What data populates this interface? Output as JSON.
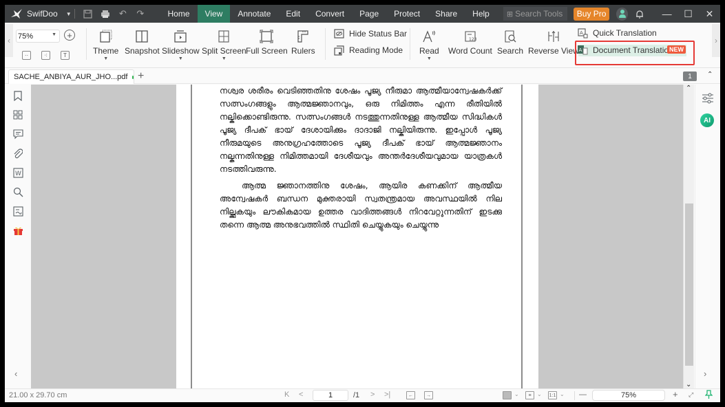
{
  "titlebar": {
    "app_name": "SwifDoo",
    "menu": [
      "Home",
      "View",
      "Annotate",
      "Edit",
      "Convert",
      "Page",
      "Protect",
      "Share",
      "Help"
    ],
    "active_menu": "View",
    "search_placeholder": "Search Tools",
    "buy_pro": "Buy Pro"
  },
  "ribbon": {
    "zoom_value": "75%",
    "tools": {
      "theme": "Theme",
      "snapshot": "Snapshot",
      "slideshow": "Slideshow",
      "split_screen": "Split Screen",
      "full_screen": "Full Screen",
      "rulers": "Rulers",
      "hide_status_bar": "Hide Status Bar",
      "reading_mode": "Reading Mode",
      "read": "Read",
      "word_count": "Word Count",
      "search": "Search",
      "reverse_view": "Reverse View",
      "quick_translation": "Quick Translation",
      "document_translation": "Document Translation",
      "new_badge": "NEW"
    }
  },
  "tabs": {
    "doc_tab": "SACHE_ANBIYA_AUR_JHO...pdf",
    "page_badge": "1"
  },
  "document": {
    "paragraph1": "നശ്വര ശരീരം വെടിഞ്ഞതിനു ശേഷം പൂജ്യ നീരുമാ ആത്മീയാന്വേഷകർക്ക് സത്സംഗങ്ങളും ആത്മജ്ഞാനവും, ഒരു നിമിത്തം എന്ന രീതിയിൽ നല്കിക്കൊണ്ടിരുന്നു. സത്സംഗങ്ങൾ നടത്തുന്നതിനുള്ള ആത്മീയ സിദ്ധികൾ പൂജ്യ ദീപക് ഭായ് ദേശായിക്കും ദാദാജി നല്കിയിരുന്നു. ഇപ്പോൾ പൂജ്യ നീരുമയുടെ അനുഗ്രഹത്തോടെ പൂജ്യ ദീപക് ഭായ് ആത്മജ്ഞാനം നല്കുന്നതിനുള്ള നിമിത്തമായി ദേശീയവും അന്തർദേശീയവുമായ യാത്രകൾ നടത്തിവരുന്നു.",
    "paragraph2": "ആത്മ ജ്ഞാനത്തിനു ശേഷം, ആയിര കണക്കിന് ആത്മീയ അന്വേഷകർ ബന്ധന മുക്തരായി സ്വതന്ത്രമായ അവസ്ഥയിൽ നില നില്ക്കുകയും ലൗകികമായ ഉത്തര വാദിത്തങ്ങൾ നിറവേറ്റുന്നതിന് ഇടക്കു തന്നെ ആത്മ അനുഭവത്തിൽ സ്ഥിതി ചെയ്യുകയും ചെയ്യുന്നു"
  },
  "sidebar_left": [
    "bookmark-icon",
    "thumbnails-icon",
    "comment-icon",
    "attachment-icon",
    "word-icon",
    "search-icon",
    "signature-icon",
    "gift-icon"
  ],
  "sidebar_right": {
    "ai_label": "AI"
  },
  "statusbar": {
    "page_size": "21.00 x 29.70 cm",
    "current_page": "1",
    "total_pages": "/1",
    "zoom_value": "75%"
  },
  "colors": {
    "titlebar_bg": "#3c3f41",
    "active_menu": "#2e7d62",
    "buy_pro": "#e5852a",
    "highlight_border": "#e53935",
    "new_badge": "#ef5a3c",
    "ai_badge": "#17b583"
  }
}
